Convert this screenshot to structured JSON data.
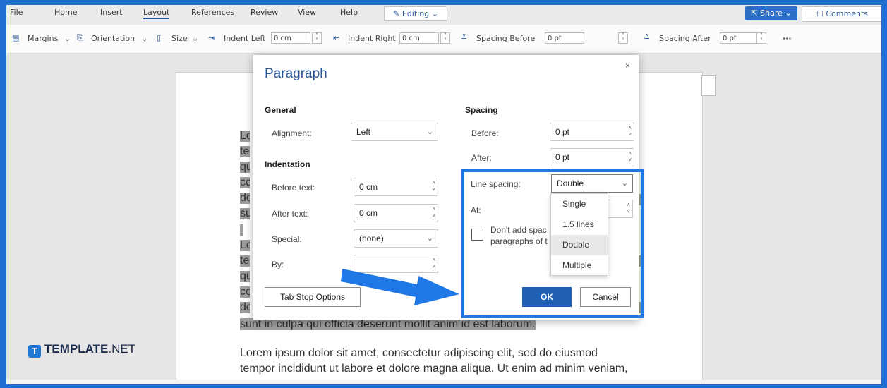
{
  "menubar": {
    "items": [
      "File",
      "Home",
      "Insert",
      "Layout",
      "References",
      "Review",
      "View",
      "Help"
    ],
    "active": "Layout",
    "editing_label": "Editing",
    "share_label": "Share",
    "comments_label": "Comments"
  },
  "ribbon": {
    "margins": "Margins",
    "orientation": "Orientation",
    "size": "Size",
    "indent_left_label": "Indent Left",
    "indent_left_value": "0 cm",
    "indent_right_label": "Indent Right",
    "indent_right_value": "0 cm",
    "spacing_before_label": "Spacing Before",
    "spacing_before_value": "0 pt",
    "spacing_after_label": "Spacing After",
    "spacing_after_value": "0 pt",
    "more": "···"
  },
  "document": {
    "fragments": [
      "Lo",
      "ter",
      "qu",
      "co",
      "do",
      "su",
      "Lo",
      "ter",
      "qu",
      "co",
      "do"
    ],
    "line_culpa": "sunt in culpa qui officia deserunt mollit anim id est laborum.",
    "line_p2_1": "Lorem ipsum dolor sit amet, consectetur adipiscing elit, sed do eiusmod",
    "line_p2_2": "tempor incididunt ut labore et dolore magna aliqua. Ut enim ad minim veniam,"
  },
  "dialog": {
    "title": "Paragraph",
    "close": "×",
    "general": {
      "heading": "General",
      "alignment_label": "Alignment:",
      "alignment_value": "Left"
    },
    "indentation": {
      "heading": "Indentation",
      "before_label": "Before text:",
      "before_value": "0 cm",
      "after_label": "After text:",
      "after_value": "0 cm",
      "special_label": "Special:",
      "special_value": "(none)",
      "by_label": "By:",
      "by_value": ""
    },
    "spacing": {
      "heading": "Spacing",
      "before_label": "Before:",
      "before_value": "0 pt",
      "after_label": "After:",
      "after_value": "0 pt",
      "line_spacing_label": "Line spacing:",
      "line_spacing_value": "Double",
      "at_label": "At:",
      "checkbox_label_1": "Don't add spac",
      "checkbox_label_2": "paragraphs of t"
    },
    "tab_stop_button": "Tab Stop Options",
    "ok_button": "OK",
    "cancel_button": "Cancel"
  },
  "line_spacing_options": [
    "Single",
    "1.5 lines",
    "Double",
    "Multiple"
  ],
  "line_spacing_selected": "Double",
  "brand": {
    "badge": "T",
    "name": "TEMPLATE",
    "suffix": ".NET"
  },
  "colors": {
    "accent": "#2b579a",
    "highlight_border": "#1f78e6",
    "arrow": "#1f78e6",
    "ok_button": "#1f5fb2"
  }
}
